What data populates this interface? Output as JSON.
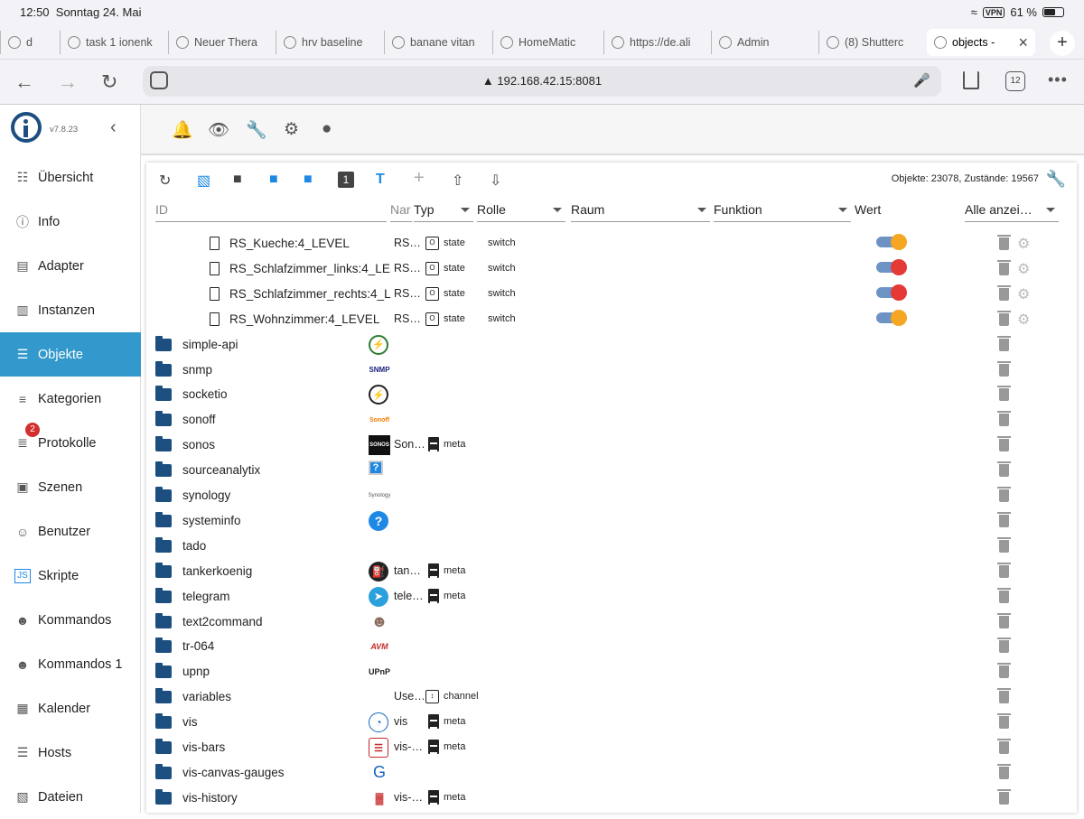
{
  "status": {
    "time": "12:50",
    "date": "Sonntag 24. Mai",
    "vpn": "VPN",
    "battery": "61 %"
  },
  "tabs": [
    {
      "title": "d",
      "icon": "globe-icon"
    },
    {
      "title": "task 1 ionenk",
      "icon": "globe-icon"
    },
    {
      "title": "Neuer Thera",
      "icon": "globe-icon"
    },
    {
      "title": "hrv baseline",
      "icon": "globe-icon"
    },
    {
      "title": "banane vitan",
      "icon": "google-icon"
    },
    {
      "title": "HomeMatic",
      "icon": "homematic-icon"
    },
    {
      "title": "https://de.ali",
      "icon": "aliexpress-icon"
    },
    {
      "title": "Admin",
      "icon": "globe-icon"
    },
    {
      "title": "(8) Shutterc",
      "icon": "iobroker-icon"
    },
    {
      "title": "objects -",
      "icon": "iobroker-icon",
      "active": true
    }
  ],
  "address": {
    "url": "▲ 192.168.42.15:8081",
    "tab_count": "12"
  },
  "brand": {
    "version": "v7.8.23"
  },
  "sidebar": {
    "items": [
      {
        "label": "Übersicht",
        "icon": "grid-icon"
      },
      {
        "label": "Info",
        "icon": "info-icon"
      },
      {
        "label": "Adapter",
        "icon": "store-icon"
      },
      {
        "label": "Instanzen",
        "icon": "instances-icon"
      },
      {
        "label": "Objekte",
        "icon": "list-icon",
        "active": true
      },
      {
        "label": "Kategorien",
        "icon": "categories-icon"
      },
      {
        "label": "Protokolle",
        "icon": "log-icon",
        "badge": "2"
      },
      {
        "label": "Szenen",
        "icon": "scenes-icon"
      },
      {
        "label": "Benutzer",
        "icon": "user-icon"
      },
      {
        "label": "Skripte",
        "icon": "js-icon"
      },
      {
        "label": "Kommandos",
        "icon": "person-speaking-icon"
      },
      {
        "label": "Kommandos 1",
        "icon": "person-speaking-icon"
      },
      {
        "label": "Kalender",
        "icon": "calendar-icon"
      },
      {
        "label": "Hosts",
        "icon": "hosts-icon"
      },
      {
        "label": "Dateien",
        "icon": "files-icon"
      }
    ]
  },
  "objects": {
    "counts": "Objekte: 23078, Zustände: 19567",
    "headers": {
      "id_placeholder": "ID",
      "name_placeholder": "Nar",
      "type": "Typ",
      "role": "Rolle",
      "room": "Raum",
      "function": "Funktion",
      "value": "Wert",
      "show_all": "Alle anzei…"
    },
    "rows": [
      {
        "kind": "state",
        "id": "RS_Kueche:4_LEVEL",
        "name": "RS…",
        "type": "state",
        "role": "switch",
        "value_color": "#f5a623"
      },
      {
        "kind": "state",
        "id": "RS_Schlafzimmer_links:4_LE",
        "name": "RS…",
        "type": "state",
        "role": "switch",
        "value_color": "#e53935"
      },
      {
        "kind": "state",
        "id": "RS_Schlafzimmer_rechts:4_L",
        "name": "RS…",
        "type": "state",
        "role": "switch",
        "value_color": "#e53935"
      },
      {
        "kind": "state",
        "id": "RS_Wohnzimmer:4_LEVEL",
        "name": "RS…",
        "type": "state",
        "role": "switch",
        "value_color": "#f5a623"
      },
      {
        "kind": "folder",
        "id": "simple-api",
        "icon": "simple-api-icon"
      },
      {
        "kind": "folder",
        "id": "snmp",
        "icon": "snmp-icon",
        "icon_text": "SNMP"
      },
      {
        "kind": "folder",
        "id": "socketio",
        "icon": "socketio-icon"
      },
      {
        "kind": "folder",
        "id": "sonoff",
        "icon": "sonoff-icon",
        "icon_text": "Sonoff"
      },
      {
        "kind": "folder",
        "id": "sonos",
        "icon": "sonos-icon",
        "icon_text": "SONOS",
        "name": "Son…",
        "type": "meta"
      },
      {
        "kind": "folder",
        "id": "sourceanalytix",
        "icon": "sourceanalytix-icon"
      },
      {
        "kind": "folder",
        "id": "synology",
        "icon": "synology-icon",
        "icon_text": "Synology"
      },
      {
        "kind": "folder",
        "id": "systeminfo",
        "icon": "question-icon"
      },
      {
        "kind": "folder",
        "id": "tado"
      },
      {
        "kind": "folder",
        "id": "tankerkoenig",
        "icon": "fuel-icon",
        "name": "tan…",
        "type": "meta"
      },
      {
        "kind": "folder",
        "id": "telegram",
        "icon": "telegram-icon",
        "name": "tele…",
        "type": "meta"
      },
      {
        "kind": "folder",
        "id": "text2command",
        "icon": "person-speaking-icon"
      },
      {
        "kind": "folder",
        "id": "tr-064",
        "icon": "avm-icon",
        "icon_text": "AVM"
      },
      {
        "kind": "folder",
        "id": "upnp",
        "icon": "upnp-icon",
        "icon_text": "UPnP"
      },
      {
        "kind": "folder",
        "id": "variables",
        "name": "Use…",
        "type": "channel",
        "type_icon": "channel-icon"
      },
      {
        "kind": "folder",
        "id": "vis",
        "icon": "vis-icon",
        "name": "vis",
        "type": "meta"
      },
      {
        "kind": "folder",
        "id": "vis-bars",
        "icon": "vis-bars-icon",
        "name": "vis-…",
        "type": "meta"
      },
      {
        "kind": "folder",
        "id": "vis-canvas-gauges",
        "icon": "gauge-icon"
      },
      {
        "kind": "folder",
        "id": "vis-history",
        "icon": "history-icon",
        "name": "vis-…",
        "type": "meta"
      }
    ]
  }
}
